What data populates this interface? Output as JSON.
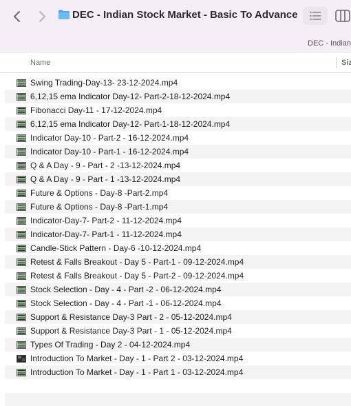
{
  "window": {
    "title": "DEC - Indian Stock Market - Basic To Advance",
    "path_label": "DEC - Indian"
  },
  "columns": {
    "name": "Name",
    "size": "Size"
  },
  "files": [
    {
      "name": "Swing Trading-Day-13- 23-12-2024.mp4",
      "icon": "video-file-icon"
    },
    {
      "name": "6,12,15 ema Indicator Day-12- Part-2-18-12-2024.mp4",
      "icon": "video-file-icon"
    },
    {
      "name": "Fibonacci Day-11 - 17-12-2024.mp4",
      "icon": "video-file-icon"
    },
    {
      "name": "6,12,15 ema Indicator Day-12- Part-1-18-12-2024.mp4",
      "icon": "video-file-icon"
    },
    {
      "name": "Indicator Day-10 - Part-2 - 16-12-2024.mp4",
      "icon": "video-file-icon"
    },
    {
      "name": "Indicator Day-10 - Part-1 - 16-12-2024.mp4",
      "icon": "video-file-icon"
    },
    {
      "name": "Q & A Day - 9 - Part - 2 -13-12-2024.mp4",
      "icon": "video-file-icon"
    },
    {
      "name": "Q & A Day - 9 - Part - 1 -13-12-2024.mp4",
      "icon": "video-file-icon"
    },
    {
      "name": "Future & Options - Day-8 -Part-2.mp4",
      "icon": "video-file-icon"
    },
    {
      "name": "Future & Options - Day-8 -Part-1.mp4",
      "icon": "video-file-icon"
    },
    {
      "name": "Indicator-Day-7- Part-2 - 11-12-2024.mp4",
      "icon": "video-file-icon"
    },
    {
      "name": "Indicator-Day-7- Part-1 - 11-12-2024.mp4",
      "icon": "video-file-icon"
    },
    {
      "name": "Candle-Stick Pattern - Day-6 -10-12-2024.mp4",
      "icon": "video-file-icon"
    },
    {
      "name": "Retest & Falls Breakout - Day 5 - Part-1 - 09-12-2024.mp4",
      "icon": "video-file-icon"
    },
    {
      "name": "Retest & Falls Breakout - Day 5 - Part-2 - 09-12-2024.mp4",
      "icon": "video-file-icon"
    },
    {
      "name": "Stock Selection - Day - 4 - Part -2 - 06-12-2024.mp4",
      "icon": "video-file-icon"
    },
    {
      "name": "Stock Selection - Day - 4 - Part -1 - 06-12-2024.mp4",
      "icon": "video-file-icon"
    },
    {
      "name": "Support & Resistance Day-3 Part - 2 - 05-12-2024.mp4",
      "icon": "video-file-icon"
    },
    {
      "name": "Support & Resistance Day-3 Part - 1 - 05-12-2024.mp4",
      "icon": "video-file-icon"
    },
    {
      "name": "Types Of Trading - Day 2 - 04-12-2024.mp4",
      "icon": "video-file-icon"
    },
    {
      "name": "Introduction To Market - Day - 1 - Part 2 - 03-12-2024.mp4",
      "icon": "video-thumbnail-icon"
    },
    {
      "name": "Introduction To Market - Day - 1 - Part 1 - 03-12-2024.mp4",
      "icon": "video-file-icon"
    }
  ],
  "colors": {
    "titlebar_bg": "#f6eef7",
    "folder_blue": "#4ea6e8",
    "row_alt": "#f4f4f5"
  }
}
